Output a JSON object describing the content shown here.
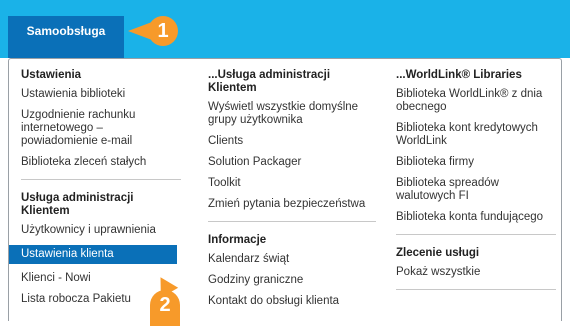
{
  "topbar": {
    "tab_label": "Samoobsługa"
  },
  "badges": {
    "first": "1",
    "second": "2"
  },
  "columns": {
    "col1": {
      "heading1": "Ustawienia",
      "items1": [
        "Ustawienia biblioteki",
        "Uzgodnienie rachunku internetowego – powiadomienie e-mail",
        "Biblioteka zleceń stałych"
      ],
      "heading2": "Usługa administracji Klientem",
      "items2": [
        "Użytkownicy i uprawnienia",
        "Ustawienia klienta",
        "Klienci - Nowi",
        "Lista robocza Pakietu"
      ]
    },
    "col2": {
      "heading1": "...Usługa administracji Klientem",
      "items1": [
        "Wyświetl wszystkie domyślne grupy użytkownika",
        "Clients",
        "Solution Packager",
        "Toolkit",
        "Zmień pytania bezpieczeństwa"
      ],
      "heading2": "Informacje",
      "items2": [
        "Kalendarz świąt",
        "Godziny graniczne",
        "Kontakt do obsługi klienta"
      ]
    },
    "col3": {
      "heading1": "...WorldLink® Libraries",
      "items1": [
        "Biblioteka WorldLink® z dnia obecnego",
        "Biblioteka kont kredytowych WorldLink",
        "Biblioteka firmy",
        "Biblioteka spreadów walutowych FI",
        "Biblioteka konta fundującego"
      ],
      "heading2": "Zlecenie usługi",
      "items2": [
        "Pokaż wszystkie"
      ]
    }
  },
  "colors": {
    "topbar": "#1ab2e8",
    "tab": "#0a70b8",
    "badge": "#f79a2a",
    "highlight": "#0a70b8"
  }
}
